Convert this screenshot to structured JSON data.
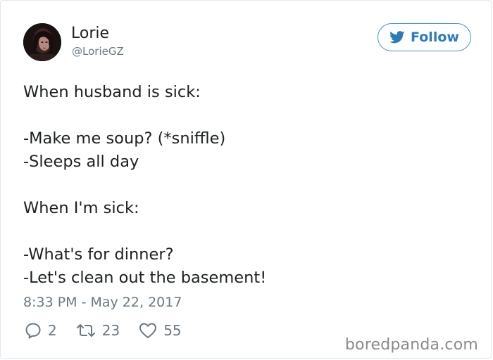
{
  "author": {
    "display_name": "Lorie",
    "handle": "@LorieGZ",
    "avatar_icon": "user-avatar-photo"
  },
  "follow_button": {
    "label": "Follow",
    "icon": "twitter-bird-icon",
    "color": "#2b7bb9",
    "border_color": "#3b94d9"
  },
  "tweet": {
    "text": "When husband is sick:\n\n-Make me soup? (*sniffle)\n-Sleeps all day\n\nWhen I'm sick:\n\n-What's for dinner?\n-Let's clean out the basement!",
    "timestamp": "8:33 PM - May 22, 2017"
  },
  "actions": {
    "replies": {
      "icon": "reply-icon",
      "count": "2"
    },
    "retweets": {
      "icon": "retweet-icon",
      "count": "23"
    },
    "likes": {
      "icon": "heart-icon",
      "count": "55"
    }
  },
  "watermark": "boredpanda.com",
  "colors": {
    "text": "#1c2022",
    "secondary_text": "#697882",
    "border": "#e1e8ed"
  }
}
